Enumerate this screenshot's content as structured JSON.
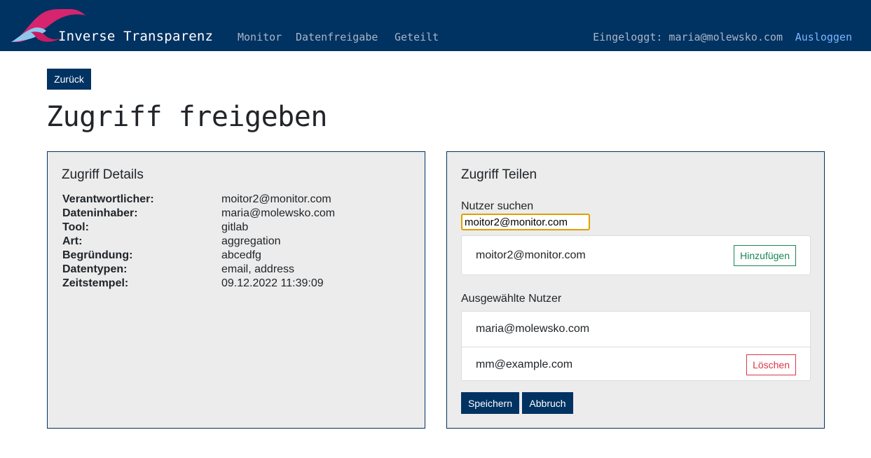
{
  "nav": {
    "brand": "Inverse Transparenz",
    "links": [
      "Monitor",
      "Datenfreigabe",
      "Geteilt"
    ],
    "logged_in": "Eingeloggt: maria@molewsko.com",
    "logout": "Ausloggen"
  },
  "back_label": "Zurück",
  "page_title": "Zugriff freigeben",
  "details": {
    "title": "Zugriff Details",
    "rows": [
      {
        "label": "Verantwortlicher:",
        "value": "moitor2@monitor.com"
      },
      {
        "label": "Dateninhaber:",
        "value": "maria@molewsko.com"
      },
      {
        "label": "Tool:",
        "value": "gitlab"
      },
      {
        "label": "Art:",
        "value": "aggregation"
      },
      {
        "label": "Begründung:",
        "value": "abcedfg"
      },
      {
        "label": "Datentypen:",
        "value": "email, address"
      },
      {
        "label": "Zeitstempel:",
        "value": "09.12.2022 11:39:09"
      }
    ]
  },
  "share": {
    "title": "Zugriff Teilen",
    "search_label": "Nutzer suchen",
    "search_value": "moitor2@monitor.com",
    "result": {
      "email": "moitor2@monitor.com",
      "add_label": "Hinzufügen"
    },
    "selected_label": "Ausgewählte Nutzer",
    "selected": [
      {
        "email": "maria@molewsko.com"
      },
      {
        "email": "mm@example.com",
        "delete_label": "Löschen"
      }
    ],
    "save_label": "Speichern",
    "cancel_label": "Abbruch"
  },
  "colors": {
    "navbar": "#003262",
    "card_background": "#ececec",
    "add_green": "#198754",
    "delete_red": "#dc3545",
    "logout_link": "#79b8ff",
    "input_focus": "#e0a000"
  },
  "icons": {
    "brand_logo": "brand-logo-icon"
  }
}
